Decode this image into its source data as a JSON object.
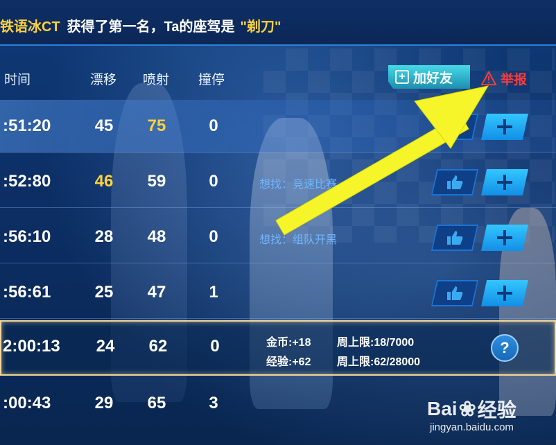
{
  "announcement": {
    "player": "铁语冰CT",
    "message": "获得了第一名，Ta的座驾是",
    "car": "\"剃刀\""
  },
  "header": {
    "time": "时间",
    "drift": "漂移",
    "jet": "喷射",
    "stop": "撞停",
    "add_friend": "加好友",
    "report": "举报"
  },
  "rows": [
    {
      "time": ":51:20",
      "drift": "45",
      "jet": "75",
      "stop": "0",
      "seek": ""
    },
    {
      "time": ":52:80",
      "drift": "46",
      "jet": "59",
      "stop": "0",
      "seek": "想找：竞速比赛"
    },
    {
      "time": ":56:10",
      "drift": "28",
      "jet": "48",
      "stop": "0",
      "seek": "想找：组队开黑"
    },
    {
      "time": ":56:61",
      "drift": "25",
      "jet": "47",
      "stop": "1",
      "seek": ""
    },
    {
      "time": "2:00:13",
      "drift": "24",
      "jet": "62",
      "stop": "0",
      "seek": ""
    },
    {
      "time": ":00:43",
      "drift": "29",
      "jet": "65",
      "stop": "3",
      "seek": ""
    }
  ],
  "reward": {
    "coin": "金币:+18",
    "coin_cap": "周上限:18/7000",
    "exp": "经验:+62",
    "exp_cap": "周上限:62/28000",
    "help": "?"
  },
  "watermark": {
    "brand": "Bai",
    "brand2": "经验",
    "url": "jingyan.baidu.com"
  },
  "colors": {
    "highlight_value": "#ffd23c",
    "report": "#ff3b3b",
    "seek_text": "#6fb6ff",
    "arrow": "#f5f52a"
  }
}
